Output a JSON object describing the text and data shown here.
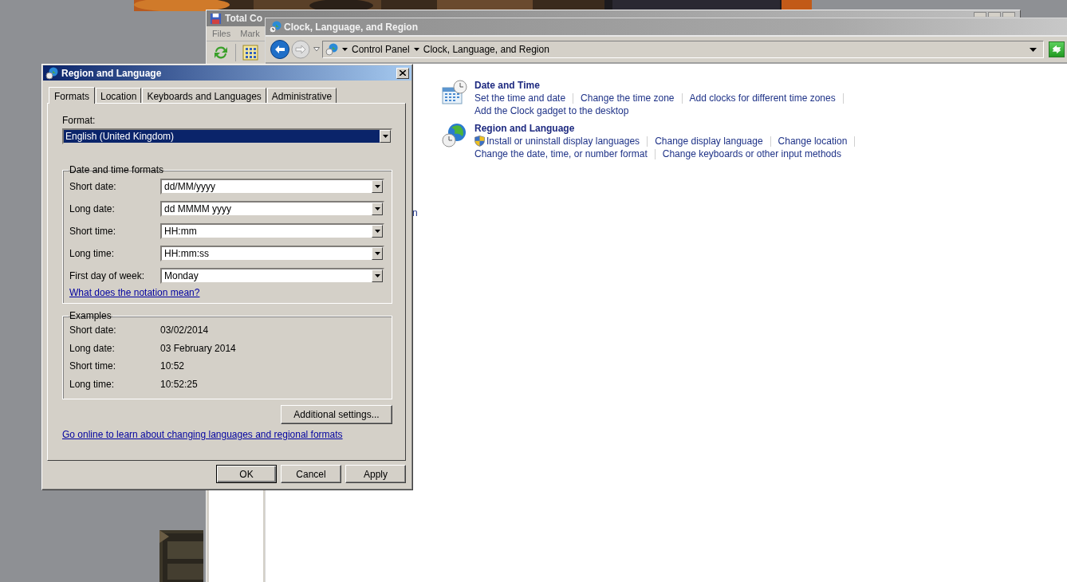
{
  "background_window": {
    "title": "Total Co",
    "menu": [
      "Files",
      "Mark"
    ]
  },
  "control_panel": {
    "title": "Clock, Language, and Region",
    "breadcrumb": [
      "Control Panel",
      "Clock, Language, and Region"
    ],
    "hidden_text_fragment": "n",
    "categories": [
      {
        "kind": "clock",
        "title": "Date and Time",
        "lines": [
          [
            {
              "text": "Set the time and date",
              "shield": false
            },
            {
              "text": "Change the time zone",
              "shield": false
            },
            {
              "text": "Add clocks for different time zones",
              "shield": false
            }
          ],
          [
            {
              "text": "Add the Clock gadget to the desktop",
              "shield": false
            }
          ]
        ]
      },
      {
        "kind": "globe",
        "title": "Region and Language",
        "lines": [
          [
            {
              "text": "Install or uninstall display languages",
              "shield": true
            },
            {
              "text": "Change display language",
              "shield": false
            },
            {
              "text": "Change location",
              "shield": false
            }
          ],
          [
            {
              "text": "Change the date, time, or number format",
              "shield": false
            },
            {
              "text": "Change keyboards or other input methods",
              "shield": false
            }
          ]
        ]
      }
    ]
  },
  "dialog": {
    "title": "Region and Language",
    "tabs": [
      {
        "label": "Formats",
        "selected": true
      },
      {
        "label": "Location",
        "selected": false
      },
      {
        "label": "Keyboards and Languages",
        "selected": false
      },
      {
        "label": "Administrative",
        "selected": false
      }
    ],
    "format": {
      "label": "Format:",
      "value": "English (United Kingdom)"
    },
    "date_time_formats": {
      "title": "Date and time formats",
      "rows": [
        {
          "label": "Short date:",
          "value": "dd/MM/yyyy"
        },
        {
          "label": "Long date:",
          "value": "dd MMMM yyyy"
        },
        {
          "label": "Short time:",
          "value": "HH:mm"
        },
        {
          "label": "Long time:",
          "value": "HH:mm:ss"
        },
        {
          "label": "First day of week:",
          "value": "Monday"
        }
      ],
      "link": "What does the notation mean?"
    },
    "examples": {
      "title": "Examples",
      "rows": [
        {
          "label": "Short date:",
          "value": "03/02/2014"
        },
        {
          "label": "Long date:",
          "value": "03 February 2014"
        },
        {
          "label": "Short time:",
          "value": "10:52"
        },
        {
          "label": "Long time:",
          "value": "10:52:25"
        }
      ]
    },
    "additional_button": "Additional settings...",
    "online_link": "Go online to learn about changing languages and regional formats",
    "buttons": [
      {
        "label": "OK",
        "default": true
      },
      {
        "label": "Cancel",
        "default": false
      },
      {
        "label": "Apply",
        "default": false
      }
    ]
  }
}
